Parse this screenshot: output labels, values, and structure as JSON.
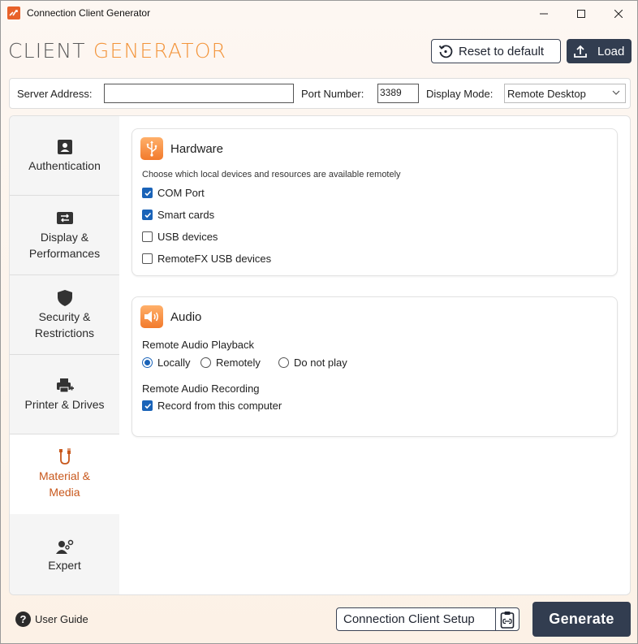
{
  "window": {
    "title": "Connection Client Generator"
  },
  "header": {
    "brand_part1": "CLIENT",
    "brand_part2": "GENERATOR",
    "reset_label": "Reset to default",
    "load_label": "Load"
  },
  "server": {
    "address_label": "Server Address:",
    "address_value": "",
    "port_label": "Port Number:",
    "port_value": "3389",
    "mode_label": "Display Mode:",
    "mode_value": "Remote Desktop"
  },
  "sidebar": {
    "items": [
      {
        "label": "Authentication",
        "icon": "id-badge-icon"
      },
      {
        "label": "Display &\nPerformances",
        "icon": "display-icon"
      },
      {
        "label": "Security &\nRestrictions",
        "icon": "shield-icon"
      },
      {
        "label": "Printer & Drives",
        "icon": "printer-icon"
      },
      {
        "label": "Material &\nMedia",
        "icon": "media-cable-icon",
        "active": true
      },
      {
        "label": "Expert",
        "icon": "expert-icon"
      }
    ]
  },
  "hardware": {
    "title": "Hardware",
    "description": "Choose which local devices and resources are available remotely",
    "options": [
      {
        "label": "COM Port",
        "checked": true
      },
      {
        "label": "Smart cards",
        "checked": true
      },
      {
        "label": "USB devices",
        "checked": false
      },
      {
        "label": "RemoteFX USB devices",
        "checked": false
      }
    ]
  },
  "audio": {
    "title": "Audio",
    "playback_label": "Remote Audio Playback",
    "playback_options": [
      {
        "label": "Locally",
        "selected": true
      },
      {
        "label": "Remotely",
        "selected": false
      },
      {
        "label": "Do not play",
        "selected": false
      }
    ],
    "recording_label": "Remote Audio Recording",
    "recording_option": {
      "label": "Record from this computer",
      "checked": true
    }
  },
  "footer": {
    "guide_label": "User Guide",
    "setup_label": "Connection Client Setup",
    "generate_label": "Generate"
  },
  "colors": {
    "accent": "#f3943a",
    "active_nav": "#c8581c",
    "primary_button": "#323d50",
    "checkbox": "#1a63b8"
  }
}
